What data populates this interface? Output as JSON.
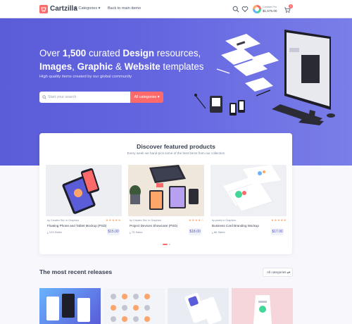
{
  "header": {
    "brand": "Cartzilla",
    "categories_label": "Categories",
    "back_label": "Back to main demo",
    "balance_label": "Creative Pro",
    "balance_value": "$1,575.00",
    "cart_count": "3"
  },
  "hero": {
    "line1_pre": "Over ",
    "line1_num": "1,500",
    "line1_mid": " curated ",
    "line1_bold": "Design",
    "line1_post": " resources,",
    "line2_a": "Images",
    "line2_sep1": ", ",
    "line2_b": "Graphic",
    "line2_sep2": " & ",
    "line2_c": "Website",
    "line2_post": " templates",
    "subtitle": "High quality items created by our global community",
    "search_placeholder": "Start your search",
    "search_button": "All categories"
  },
  "featured": {
    "title": "Discover featured products",
    "subtitle": "Every week we hand-pick some of the best items from our collection",
    "products": [
      {
        "category": "by Createx Std. in Graphics",
        "name": "Floating Phone and Tablet Mockup (PSD)",
        "sales": "129 Sales",
        "price": "$15.00",
        "stars": "★★★★★"
      },
      {
        "category": "by Createx Std. in Graphics",
        "name": "Project Devices Showcase (PSD)",
        "sales": "75 Sales",
        "price": "$18.00",
        "stars": "★★★★☆"
      },
      {
        "category": "by pixels in Graphics",
        "name": "Business Card Branding Mockup",
        "sales": "86 Sales",
        "price": "$17.00",
        "stars": "★★★★★"
      }
    ]
  },
  "recent": {
    "title": "The most recent releases",
    "filter": "All categories"
  }
}
